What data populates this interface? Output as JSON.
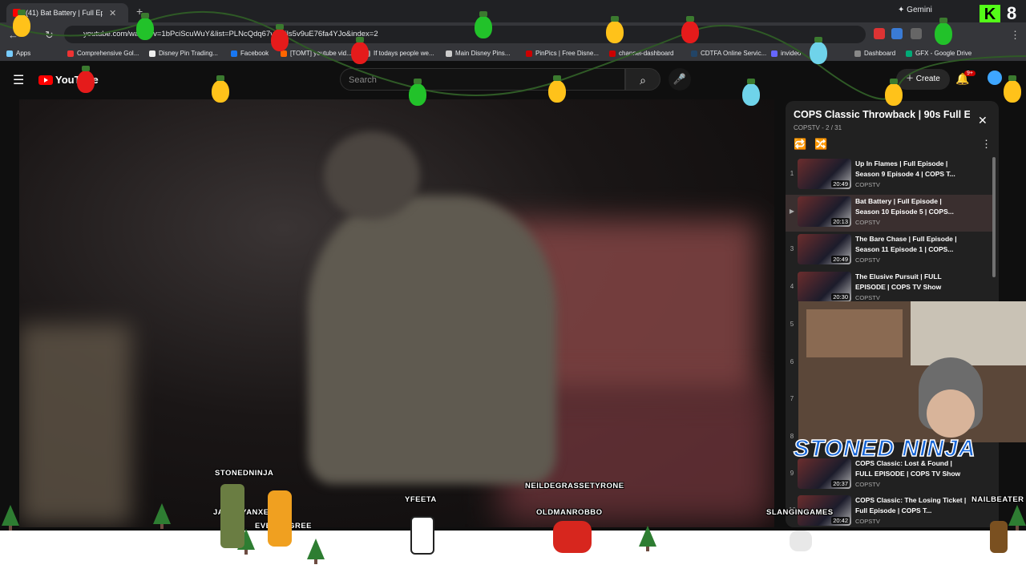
{
  "browser": {
    "tab_title": "(41) Bat Battery | Full Episod",
    "gemini_label": "Gemini",
    "url": "youtube.com/watch?v=1bPciScuWuY&list=PLNcQdq67vkWils5v9uE76fa4YJo&index=2",
    "bookmarks": [
      "Apps",
      "Comprehensive Gol...",
      "Disney Pin Trading...",
      "Facebook",
      "[TOMT] youtube vid...",
      "If todays people we...",
      "Main Disney Pins...",
      "PinPics | Free Disne...",
      "channel-dashboard",
      "CDTFA Online Servic...",
      "invideo",
      "Dashboard",
      "GFX - Google Drive"
    ]
  },
  "youtube": {
    "logo_text": "YouTube",
    "search_placeholder": "Search",
    "create_label": "Create",
    "notif_count": "9+"
  },
  "playlist": {
    "title": "COPS Classic Throwback | 90s Full E...",
    "channel": "COPSTV",
    "position": "2 / 31",
    "items": [
      {
        "index": "1",
        "title": "Up In Flames | Full Episode | Season 9 Episode 4 | COPS T...",
        "channel": "COPSTV",
        "duration": "20:49"
      },
      {
        "index": "▶",
        "title": "Bat Battery | Full Episode | Season 10 Episode 5 | COPS...",
        "channel": "COPSTV",
        "duration": "20:13"
      },
      {
        "index": "3",
        "title": "The Bare Chase | Full Episode | Season 11 Episode 1 | COPS...",
        "channel": "COPSTV",
        "duration": "20:49"
      },
      {
        "index": "4",
        "title": "The Elusive Pursuit | FULL EPISODE | COPS TV Show",
        "channel": "COPSTV",
        "duration": "20:30"
      }
    ],
    "hidden_indices": [
      "5",
      "6",
      "7",
      "8"
    ],
    "lower_items": [
      {
        "index": "9",
        "title": "COPS Classic: Lost & Found | FULL EPISODE | COPS TV Show",
        "channel": "COPSTV",
        "duration": "20:37"
      },
      {
        "index": "10",
        "title": "COPS Classic: The Losing Ticket | Full Episode | COPS T...",
        "channel": "COPSTV",
        "duration": "20:42"
      }
    ]
  },
  "overlay": {
    "streamer_name": "STONED NINJA",
    "kick_count": "8",
    "chatters": [
      "STONEDNINJA",
      "JAMESYANXE",
      "EVENDEGREE",
      "YFEETA",
      "NEILDEGRASSETYRONE",
      "OLDMANROBBO",
      "SLANGINGAMES",
      "NAILBEATER"
    ]
  }
}
